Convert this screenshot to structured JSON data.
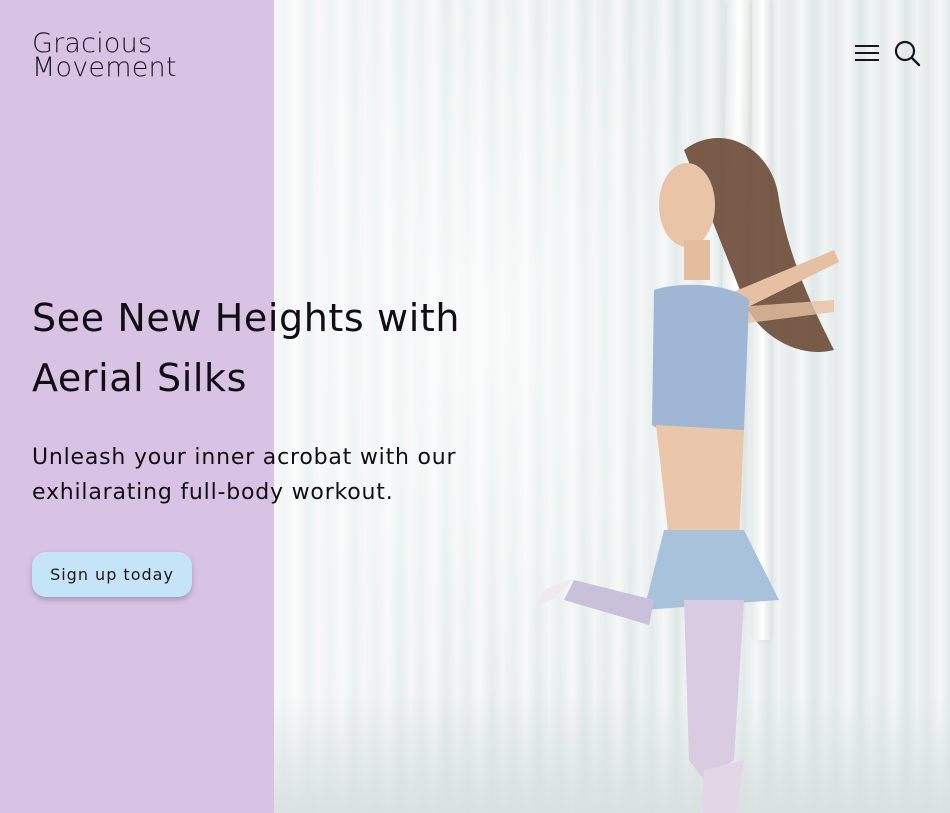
{
  "brand": {
    "line1": "Gracious",
    "line2": "Movement"
  },
  "header": {
    "menu_icon": "hamburger-menu-icon",
    "search_icon": "search-icon"
  },
  "hero": {
    "title": "See New Heights with Aerial Silks",
    "subtitle": "Unleash your inner acrobat with our exhilarating full-body workout.",
    "cta_label": "Sign up today",
    "image": "aerial-silks-photo"
  },
  "colors": {
    "panel_bg": "#d9c3e4",
    "cta_bg": "#c6e4f8",
    "text": "#120d15"
  }
}
